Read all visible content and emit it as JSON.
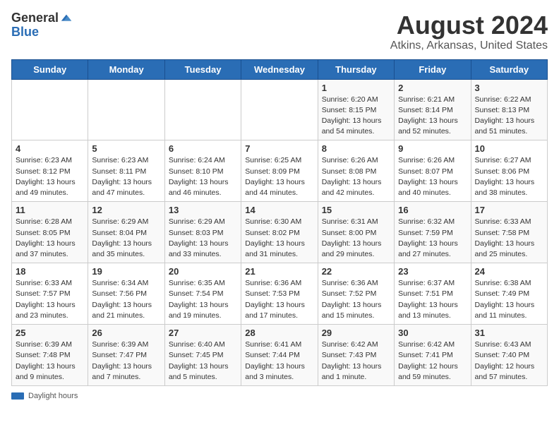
{
  "logo": {
    "general": "General",
    "blue": "Blue"
  },
  "title": "August 2024",
  "subtitle": "Atkins, Arkansas, United States",
  "days_of_week": [
    "Sunday",
    "Monday",
    "Tuesday",
    "Wednesday",
    "Thursday",
    "Friday",
    "Saturday"
  ],
  "weeks": [
    [
      {
        "day": "",
        "sunrise": "",
        "sunset": "",
        "daylight": ""
      },
      {
        "day": "",
        "sunrise": "",
        "sunset": "",
        "daylight": ""
      },
      {
        "day": "",
        "sunrise": "",
        "sunset": "",
        "daylight": ""
      },
      {
        "day": "",
        "sunrise": "",
        "sunset": "",
        "daylight": ""
      },
      {
        "day": "1",
        "sunrise": "Sunrise: 6:20 AM",
        "sunset": "Sunset: 8:15 PM",
        "daylight": "Daylight: 13 hours and 54 minutes."
      },
      {
        "day": "2",
        "sunrise": "Sunrise: 6:21 AM",
        "sunset": "Sunset: 8:14 PM",
        "daylight": "Daylight: 13 hours and 52 minutes."
      },
      {
        "day": "3",
        "sunrise": "Sunrise: 6:22 AM",
        "sunset": "Sunset: 8:13 PM",
        "daylight": "Daylight: 13 hours and 51 minutes."
      }
    ],
    [
      {
        "day": "4",
        "sunrise": "Sunrise: 6:23 AM",
        "sunset": "Sunset: 8:12 PM",
        "daylight": "Daylight: 13 hours and 49 minutes."
      },
      {
        "day": "5",
        "sunrise": "Sunrise: 6:23 AM",
        "sunset": "Sunset: 8:11 PM",
        "daylight": "Daylight: 13 hours and 47 minutes."
      },
      {
        "day": "6",
        "sunrise": "Sunrise: 6:24 AM",
        "sunset": "Sunset: 8:10 PM",
        "daylight": "Daylight: 13 hours and 46 minutes."
      },
      {
        "day": "7",
        "sunrise": "Sunrise: 6:25 AM",
        "sunset": "Sunset: 8:09 PM",
        "daylight": "Daylight: 13 hours and 44 minutes."
      },
      {
        "day": "8",
        "sunrise": "Sunrise: 6:26 AM",
        "sunset": "Sunset: 8:08 PM",
        "daylight": "Daylight: 13 hours and 42 minutes."
      },
      {
        "day": "9",
        "sunrise": "Sunrise: 6:26 AM",
        "sunset": "Sunset: 8:07 PM",
        "daylight": "Daylight: 13 hours and 40 minutes."
      },
      {
        "day": "10",
        "sunrise": "Sunrise: 6:27 AM",
        "sunset": "Sunset: 8:06 PM",
        "daylight": "Daylight: 13 hours and 38 minutes."
      }
    ],
    [
      {
        "day": "11",
        "sunrise": "Sunrise: 6:28 AM",
        "sunset": "Sunset: 8:05 PM",
        "daylight": "Daylight: 13 hours and 37 minutes."
      },
      {
        "day": "12",
        "sunrise": "Sunrise: 6:29 AM",
        "sunset": "Sunset: 8:04 PM",
        "daylight": "Daylight: 13 hours and 35 minutes."
      },
      {
        "day": "13",
        "sunrise": "Sunrise: 6:29 AM",
        "sunset": "Sunset: 8:03 PM",
        "daylight": "Daylight: 13 hours and 33 minutes."
      },
      {
        "day": "14",
        "sunrise": "Sunrise: 6:30 AM",
        "sunset": "Sunset: 8:02 PM",
        "daylight": "Daylight: 13 hours and 31 minutes."
      },
      {
        "day": "15",
        "sunrise": "Sunrise: 6:31 AM",
        "sunset": "Sunset: 8:00 PM",
        "daylight": "Daylight: 13 hours and 29 minutes."
      },
      {
        "day": "16",
        "sunrise": "Sunrise: 6:32 AM",
        "sunset": "Sunset: 7:59 PM",
        "daylight": "Daylight: 13 hours and 27 minutes."
      },
      {
        "day": "17",
        "sunrise": "Sunrise: 6:33 AM",
        "sunset": "Sunset: 7:58 PM",
        "daylight": "Daylight: 13 hours and 25 minutes."
      }
    ],
    [
      {
        "day": "18",
        "sunrise": "Sunrise: 6:33 AM",
        "sunset": "Sunset: 7:57 PM",
        "daylight": "Daylight: 13 hours and 23 minutes."
      },
      {
        "day": "19",
        "sunrise": "Sunrise: 6:34 AM",
        "sunset": "Sunset: 7:56 PM",
        "daylight": "Daylight: 13 hours and 21 minutes."
      },
      {
        "day": "20",
        "sunrise": "Sunrise: 6:35 AM",
        "sunset": "Sunset: 7:54 PM",
        "daylight": "Daylight: 13 hours and 19 minutes."
      },
      {
        "day": "21",
        "sunrise": "Sunrise: 6:36 AM",
        "sunset": "Sunset: 7:53 PM",
        "daylight": "Daylight: 13 hours and 17 minutes."
      },
      {
        "day": "22",
        "sunrise": "Sunrise: 6:36 AM",
        "sunset": "Sunset: 7:52 PM",
        "daylight": "Daylight: 13 hours and 15 minutes."
      },
      {
        "day": "23",
        "sunrise": "Sunrise: 6:37 AM",
        "sunset": "Sunset: 7:51 PM",
        "daylight": "Daylight: 13 hours and 13 minutes."
      },
      {
        "day": "24",
        "sunrise": "Sunrise: 6:38 AM",
        "sunset": "Sunset: 7:49 PM",
        "daylight": "Daylight: 13 hours and 11 minutes."
      }
    ],
    [
      {
        "day": "25",
        "sunrise": "Sunrise: 6:39 AM",
        "sunset": "Sunset: 7:48 PM",
        "daylight": "Daylight: 13 hours and 9 minutes."
      },
      {
        "day": "26",
        "sunrise": "Sunrise: 6:39 AM",
        "sunset": "Sunset: 7:47 PM",
        "daylight": "Daylight: 13 hours and 7 minutes."
      },
      {
        "day": "27",
        "sunrise": "Sunrise: 6:40 AM",
        "sunset": "Sunset: 7:45 PM",
        "daylight": "Daylight: 13 hours and 5 minutes."
      },
      {
        "day": "28",
        "sunrise": "Sunrise: 6:41 AM",
        "sunset": "Sunset: 7:44 PM",
        "daylight": "Daylight: 13 hours and 3 minutes."
      },
      {
        "day": "29",
        "sunrise": "Sunrise: 6:42 AM",
        "sunset": "Sunset: 7:43 PM",
        "daylight": "Daylight: 13 hours and 1 minute."
      },
      {
        "day": "30",
        "sunrise": "Sunrise: 6:42 AM",
        "sunset": "Sunset: 7:41 PM",
        "daylight": "Daylight: 12 hours and 59 minutes."
      },
      {
        "day": "31",
        "sunrise": "Sunrise: 6:43 AM",
        "sunset": "Sunset: 7:40 PM",
        "daylight": "Daylight: 12 hours and 57 minutes."
      }
    ]
  ],
  "footer": {
    "daylight_label": "Daylight hours"
  }
}
